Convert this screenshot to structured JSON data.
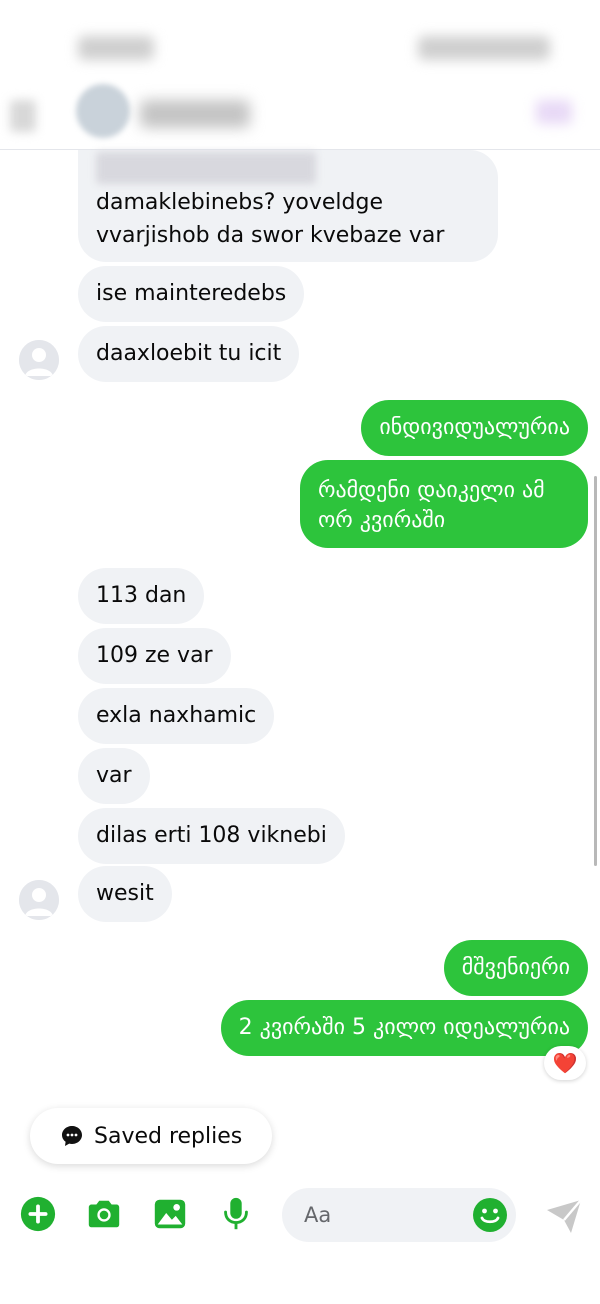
{
  "colors": {
    "outgoing_bubble": "#2dc43c",
    "incoming_bubble": "#f0f2f5",
    "accent": "#20b030"
  },
  "messages": {
    "m1": "damaklebinebs? yoveldge vvarjishob da swor kvebaze var",
    "m2": "ise mainteredebs",
    "m3": "daaxloebit tu icit",
    "m4": "ინდივიდუალურია",
    "m5": "რამდენი დაიკელი ამ ორ კვირაში",
    "m6": "113 dan",
    "m7": "109 ze var",
    "m8": "exla naxhamic",
    "m9": "var",
    "m10": "dilas erti 108 viknebi",
    "m11": "wesit",
    "m12": "მშვენიერი",
    "m13": "2 კვირაში 5 კილო იდეალურია"
  },
  "reaction": "❤️",
  "saved_replies": {
    "label": "Saved replies",
    "icon": "chat-bubble-icon"
  },
  "composer": {
    "placeholder": "Aa",
    "icons": [
      "plus-icon",
      "camera-icon",
      "image-icon",
      "microphone-icon",
      "smile-icon",
      "send-icon"
    ]
  }
}
